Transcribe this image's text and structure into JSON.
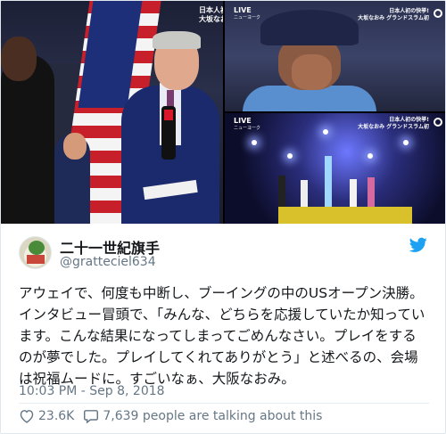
{
  "media": {
    "main_overlay_text": "日本人初の\n大坂なおみ グラント",
    "top_right": {
      "live_label": "LIVE",
      "live_sub": "ニューヨーク",
      "ticker": "日本人初の快挙!\n大坂なおみ グランドスラム初"
    },
    "bottom_right": {
      "live_label": "LIVE",
      "live_sub": "ニューヨーク",
      "ticker": "日本人初の快挙!\n大坂なおみ グランドスラム初"
    }
  },
  "tweet": {
    "author_name": "二十一世紀旗手",
    "author_handle": "@gratteciel634",
    "text": "アウェイで、何度も中断し、ブーイングの中のUSオープン決勝。インタビュー冒頭で、「みんな、どちらを応援していたか知っています。こんな結果になってしまってごめんなさい。プレイをするのが夢でした。プレイしてくれてありがとう」と述べるの、会場は祝福ムードに。すごいなぁ、大阪なおみ。",
    "timestamp": "10:03 PM - Sep 8, 2018",
    "likes": "23.6K",
    "replies_text": "7,639 people are talking about this"
  },
  "colors": {
    "twitter_blue": "#1da1f2",
    "secondary_text": "#657786",
    "primary_text": "#14171a"
  },
  "icons": [
    "twitter-bird-icon",
    "heart-icon",
    "speech-bubble-icon"
  ]
}
